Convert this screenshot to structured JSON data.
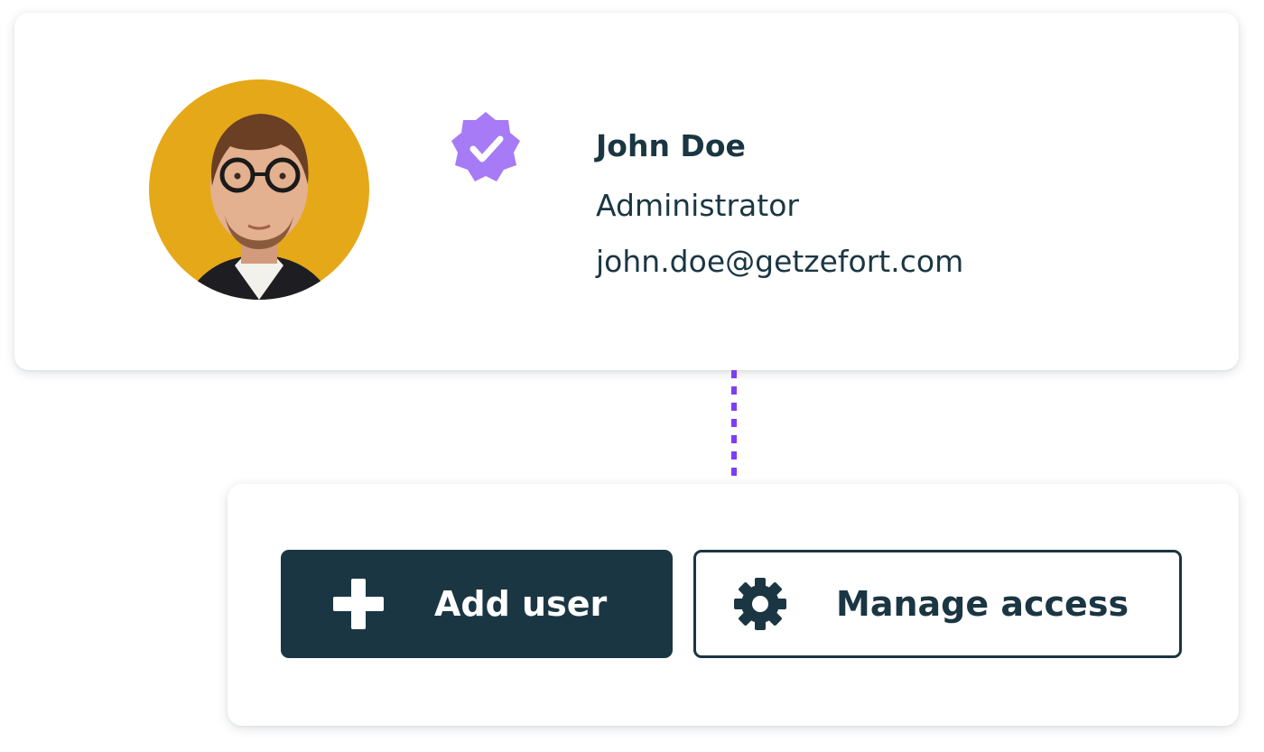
{
  "profile": {
    "name": "John Doe",
    "role": "Administrator",
    "email": "john.doe@getzefort.com",
    "avatar_icon": "user-photo",
    "verified_icon": "verified-badge-icon"
  },
  "actions": {
    "add_user": {
      "label": "Add user",
      "icon": "plus-icon"
    },
    "manage_access": {
      "label": "Manage access",
      "icon": "gear-icon"
    }
  },
  "colors": {
    "primary_dark": "#1b3643",
    "accent_purple": "#a77bf5",
    "connector_purple": "#7b3ff2",
    "avatar_background": "#e5a818",
    "card_background": "#ffffff"
  }
}
